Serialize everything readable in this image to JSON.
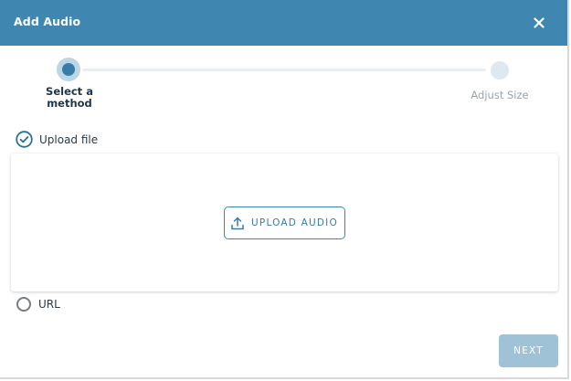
{
  "dialog": {
    "title": "Add Audio",
    "close_icon": "close-icon"
  },
  "stepper": {
    "steps": [
      {
        "label": "Select a method",
        "state": "active"
      },
      {
        "label": "Adjust Size",
        "state": "inactive"
      }
    ]
  },
  "options": {
    "upload": {
      "label": "Upload file",
      "selected": true,
      "icon": "check-circle-icon"
    },
    "url": {
      "label": "URL",
      "selected": false,
      "icon": "radio-unchecked-icon"
    }
  },
  "upload_panel": {
    "button_label": "UPLOAD AUDIO",
    "button_icon": "upload-icon"
  },
  "footer": {
    "next_label": "NEXT"
  },
  "colors": {
    "header": "#3f87b0",
    "accent": "#357ea8",
    "next_disabled": "#9fc2d6"
  }
}
